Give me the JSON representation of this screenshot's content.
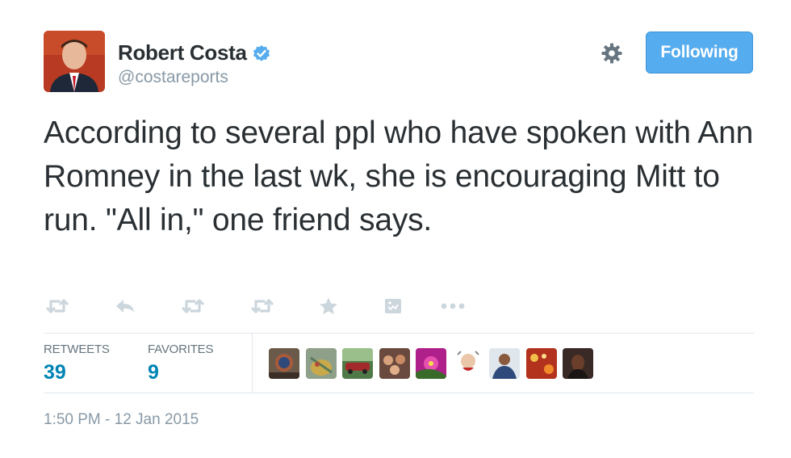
{
  "author": {
    "name": "Robert Costa",
    "handle": "@costareports",
    "verified": true,
    "avatar_icon": "author-avatar-photo"
  },
  "follow_button": {
    "label": "Following",
    "color": "#55acee"
  },
  "tweet": {
    "text": "According to several ppl who have spoken with Ann Romney in the last wk, she is encouraging Mitt to run. \"All in,\" one friend says."
  },
  "actions": [
    {
      "icon": "retweet-icon"
    },
    {
      "icon": "reply-icon"
    },
    {
      "icon": "retweet-icon"
    },
    {
      "icon": "retweet-icon"
    },
    {
      "icon": "star-icon"
    },
    {
      "icon": "embed-icon"
    },
    {
      "icon": "more-icon"
    }
  ],
  "stats": {
    "retweets": {
      "label": "RETWEETS",
      "value": "39"
    },
    "favorites": {
      "label": "FAVORITES",
      "value": "9"
    }
  },
  "favoriters": [
    {
      "icon": "favoriter-avatar",
      "color": "#6b5a4a"
    },
    {
      "icon": "favoriter-avatar",
      "color": "#8fa08a"
    },
    {
      "icon": "favoriter-avatar",
      "color": "#4f7a48"
    },
    {
      "icon": "favoriter-avatar",
      "color": "#6a4a3e"
    },
    {
      "icon": "favoriter-avatar",
      "color": "#b0208a"
    },
    {
      "icon": "favoriter-avatar",
      "color": "#e9e3dc"
    },
    {
      "icon": "favoriter-avatar",
      "color": "#3a4a6a"
    },
    {
      "icon": "favoriter-avatar",
      "color": "#b3321e"
    },
    {
      "icon": "favoriter-avatar",
      "color": "#3a2a26"
    }
  ],
  "timestamp": "1:50 PM - 12 Jan 2015",
  "colors": {
    "text": "#292f33",
    "muted": "#8899a6",
    "link": "#0084b4",
    "icon": "#ccd6dd"
  }
}
